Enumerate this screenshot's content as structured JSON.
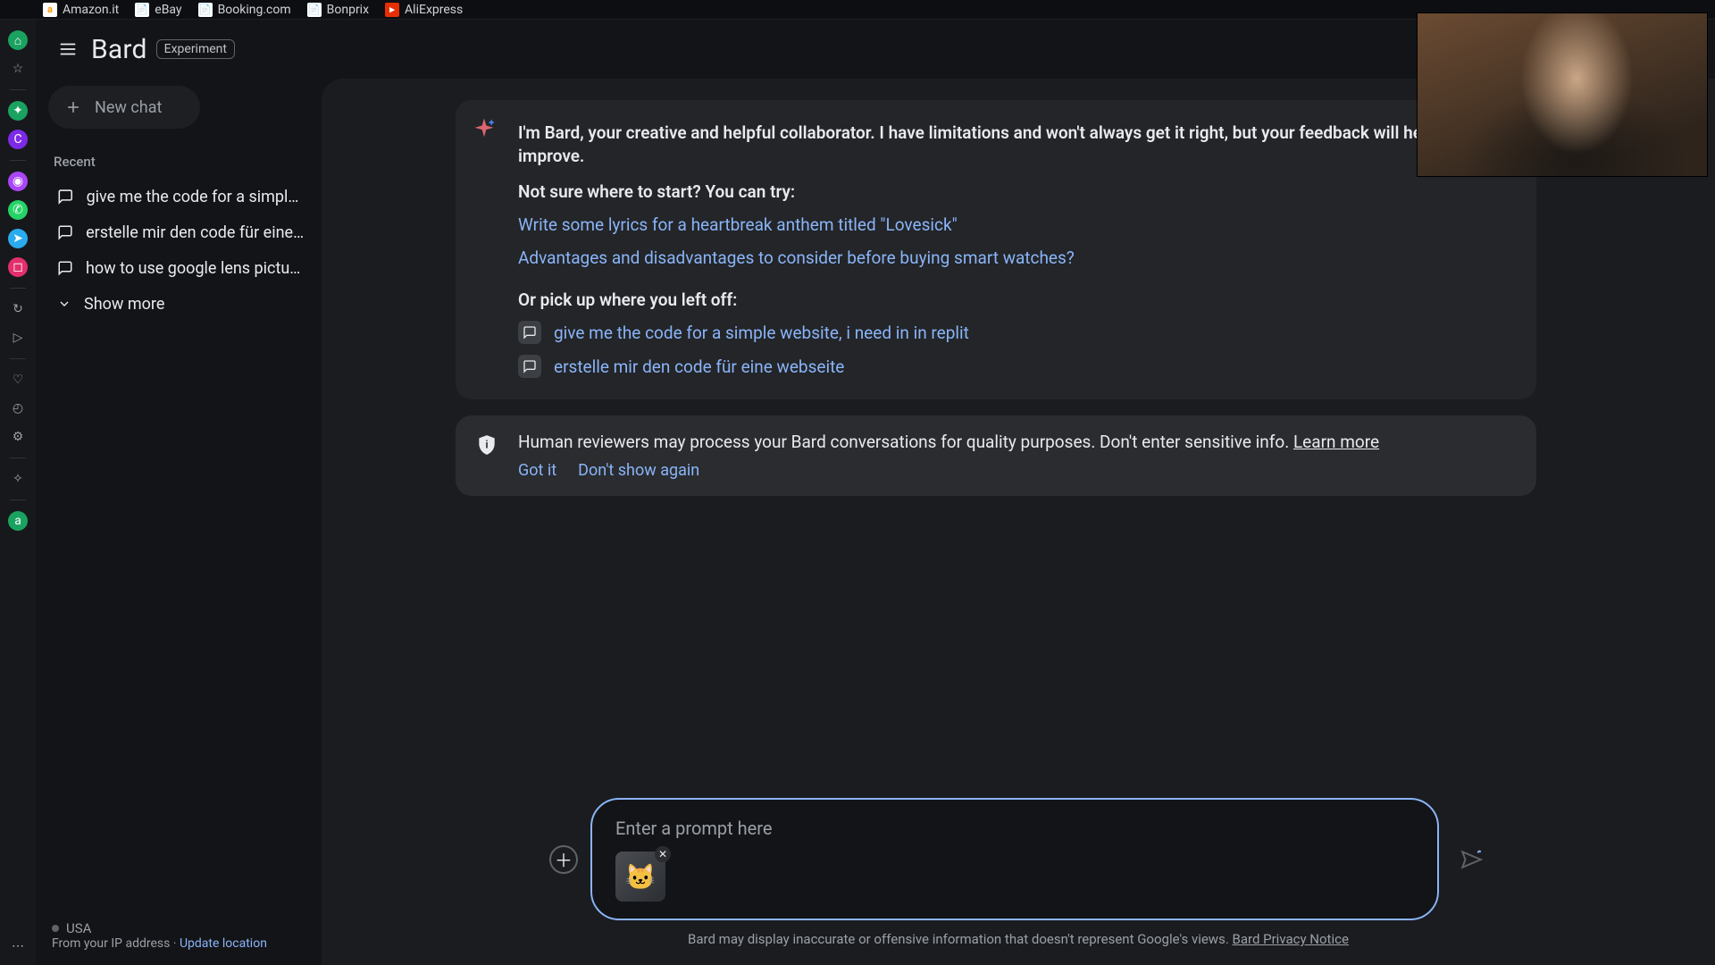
{
  "bookmarks": [
    {
      "label": "Amazon.it",
      "icon_bg": "#ffffff",
      "icon_fg": "#ff9900",
      "icon_letter": "a"
    },
    {
      "label": "eBay",
      "icon_bg": "#ffffff",
      "icon_fg": "#333333",
      "icon_letter": "📄"
    },
    {
      "label": "Booking.com",
      "icon_bg": "#ffffff",
      "icon_fg": "#003580",
      "icon_letter": "📄"
    },
    {
      "label": "Bonprix",
      "icon_bg": "#ffffff",
      "icon_fg": "#333333",
      "icon_letter": "📄"
    },
    {
      "label": "AliExpress",
      "icon_bg": "#e62e04",
      "icon_fg": "#ffffff",
      "icon_letter": "▸"
    }
  ],
  "rail": {
    "items": [
      {
        "name": "home-icon",
        "glyph": "⌂",
        "bg": "#1aa260",
        "fg": "#ffffff"
      },
      {
        "name": "star-icon",
        "glyph": "☆",
        "bg": "",
        "fg": "#9aa0a6"
      },
      {
        "name": "sep"
      },
      {
        "name": "bard-icon",
        "glyph": "✦",
        "bg": "#1aa260",
        "fg": "#ffffff"
      },
      {
        "name": "canva-icon",
        "glyph": "C",
        "bg": "#7d2ae8",
        "fg": "#ffffff"
      },
      {
        "name": "sep"
      },
      {
        "name": "messenger-icon",
        "glyph": "◉",
        "bg": "#a946f6",
        "fg": "#ffffff"
      },
      {
        "name": "whatsapp-icon",
        "glyph": "✆",
        "bg": "#25d366",
        "fg": "#ffffff"
      },
      {
        "name": "telegram-icon",
        "glyph": "➤",
        "bg": "#2aabee",
        "fg": "#ffffff"
      },
      {
        "name": "instagram-icon",
        "glyph": "◻",
        "bg": "#e1306c",
        "fg": "#ffffff"
      },
      {
        "name": "sep"
      },
      {
        "name": "history-icon",
        "glyph": "↻",
        "bg": "",
        "fg": "#9aa0a6"
      },
      {
        "name": "play-icon",
        "glyph": "▷",
        "bg": "",
        "fg": "#9aa0a6"
      },
      {
        "name": "sep"
      },
      {
        "name": "heart-icon",
        "glyph": "♡",
        "bg": "",
        "fg": "#9aa0a6"
      },
      {
        "name": "clock-icon",
        "glyph": "◴",
        "bg": "",
        "fg": "#9aa0a6"
      },
      {
        "name": "gear-icon",
        "glyph": "⚙",
        "bg": "",
        "fg": "#9aa0a6"
      },
      {
        "name": "sep"
      },
      {
        "name": "sparkle-icon",
        "glyph": "✧",
        "bg": "",
        "fg": "#9aa0a6"
      },
      {
        "name": "sep"
      },
      {
        "name": "avatar-icon",
        "glyph": "a",
        "bg": "#1aa260",
        "fg": "#ffffff"
      }
    ],
    "more_glyph": "⋯"
  },
  "header": {
    "title": "Bard",
    "badge": "Experiment"
  },
  "sidebar": {
    "new_chat": "New chat",
    "recent_label": "Recent",
    "recent": [
      "give me the code for a simple w…",
      "erstelle mir den code für eine we…",
      "how to use google lens pictures i…"
    ],
    "show_more": "Show more",
    "location": {
      "country": "USA",
      "ip_text": "From your IP address",
      "separator": " · ",
      "update": "Update location"
    }
  },
  "intro": {
    "line": "I'm Bard, your creative and helpful collaborator. I have limitations and won't always get it right, but your feedback will help me improve.",
    "try_label": "Not sure where to start? You can try:",
    "suggestions": [
      "Write some lyrics for a heartbreak anthem titled \"Lovesick\"",
      "Advantages and disadvantages to consider before buying smart watches?"
    ],
    "pickup_label": "Or pick up where you left off:",
    "pickup": [
      "give me the code for a simple website, i need in in replit",
      "erstelle mir den code für eine webseite"
    ]
  },
  "notice": {
    "text": "Human reviewers may process your Bard conversations for quality purposes. Don't enter sensitive info. ",
    "learn": "Learn more",
    "got_it": "Got it",
    "dont_show": "Don't show again"
  },
  "prompt": {
    "placeholder": "Enter a prompt here"
  },
  "disclaimer": {
    "text": "Bard may display inaccurate or offensive information that doesn't represent Google's views. ",
    "link": "Bard Privacy Notice"
  },
  "colors": {
    "link": "#8ab4f8"
  }
}
